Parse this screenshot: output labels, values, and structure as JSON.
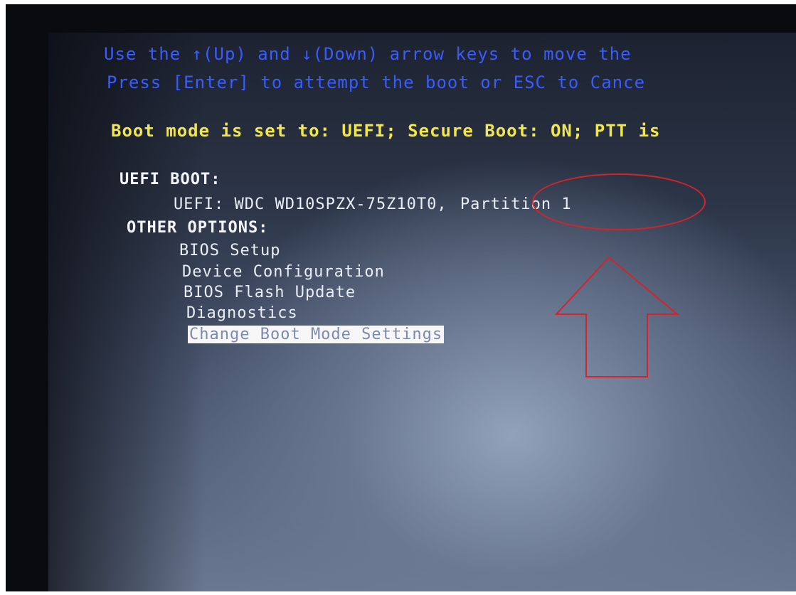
{
  "instructions": {
    "line1": "Use the ↑(Up) and ↓(Down) arrow keys to move the",
    "line2": "Press [Enter] to attempt the boot or ESC to Cance"
  },
  "boot_mode_status": "Boot mode is set to: UEFI; Secure Boot: ON; PTT is",
  "uefi_boot": {
    "header": "UEFI BOOT:",
    "entries": [
      {
        "label_prefix": "UEFI: WDC WD10SPZX-75Z10T0,",
        "label_partition": "Partition 1"
      }
    ]
  },
  "other_options": {
    "header": "OTHER OPTIONS:",
    "items": [
      {
        "label": "BIOS Setup",
        "selected": false
      },
      {
        "label": "Device Configuration",
        "selected": false
      },
      {
        "label": "BIOS Flash Update",
        "selected": false
      },
      {
        "label": "Diagnostics",
        "selected": false
      },
      {
        "label": "Change Boot Mode Settings",
        "selected": true
      }
    ]
  },
  "annotation": {
    "highlight_color": "#d7222a",
    "highlight_target": "Partition 1",
    "arrow_icon": "up-arrow-outline-icon"
  },
  "colors": {
    "instruction_text": "#3a5cff",
    "status_text": "#f2e64a",
    "menu_text": "#e9edf5",
    "selection_bg": "#f7f7f7"
  }
}
